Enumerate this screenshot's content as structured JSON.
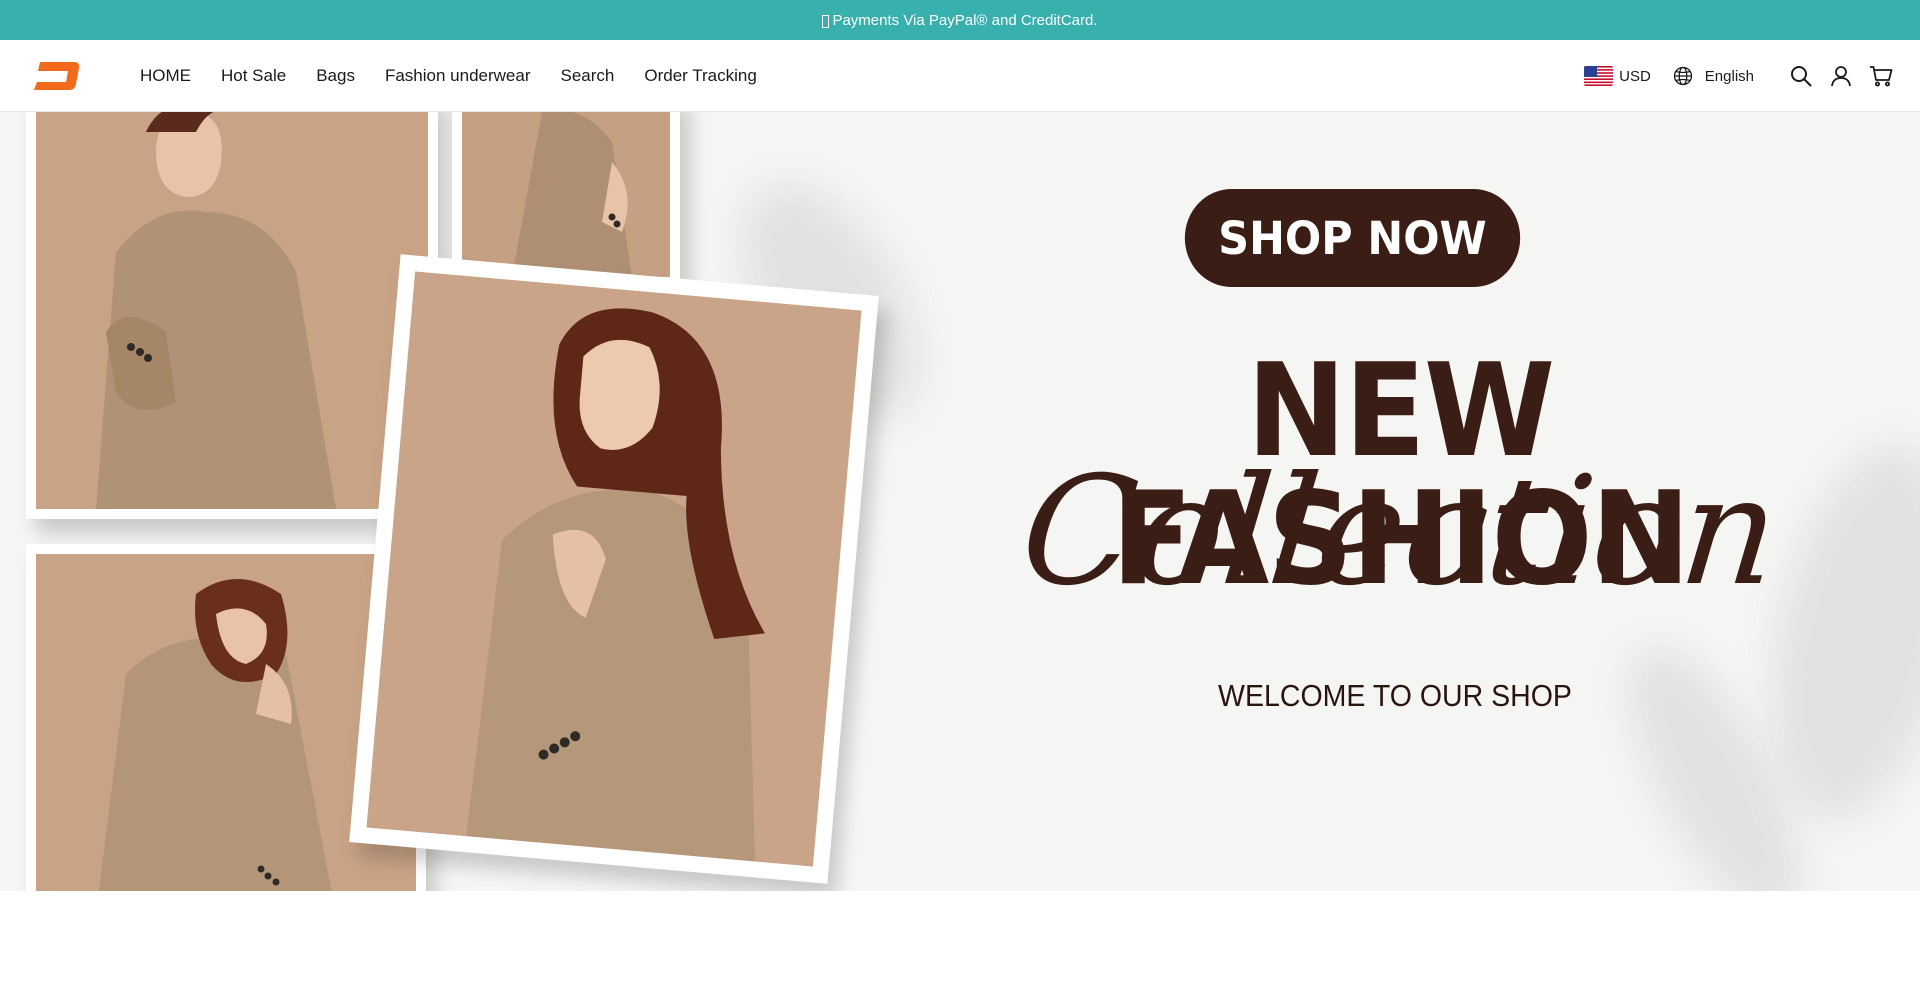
{
  "announcement": {
    "text": "Payments Via PayPal® and CreditCard.",
    "icon": "missing-glyph-box"
  },
  "brand": {
    "logo_icon": "brand-logo-icon",
    "accent_color": "#f26a1b"
  },
  "nav": {
    "items": [
      {
        "label": "HOME"
      },
      {
        "label": "Hot Sale"
      },
      {
        "label": "Bags"
      },
      {
        "label": "Fashion underwear"
      },
      {
        "label": "Search"
      },
      {
        "label": "Order Tracking"
      }
    ]
  },
  "tools": {
    "currency": {
      "flag_icon": "us-flag-icon",
      "label": "USD"
    },
    "language": {
      "icon": "globe-icon",
      "label": "English"
    },
    "search_icon": "search-icon",
    "account_icon": "user-icon",
    "cart_icon": "cart-icon"
  },
  "hero": {
    "cta_label": "SHOP NOW",
    "headline": "NEW FASHION",
    "script_line": "Collection",
    "tagline": "WELCOME TO OUR SHOP",
    "text_color": "#3a1d14",
    "background_color": "#f5f5f3",
    "photos": [
      "woman-in-beige-coat-photo-1",
      "woman-in-beige-coat-photo-2",
      "woman-in-beige-coat-photo-3",
      "woman-in-beige-coat-photo-4"
    ]
  },
  "colors": {
    "announcement_bg": "#38b0ae",
    "header_bg": "#ffffff"
  }
}
